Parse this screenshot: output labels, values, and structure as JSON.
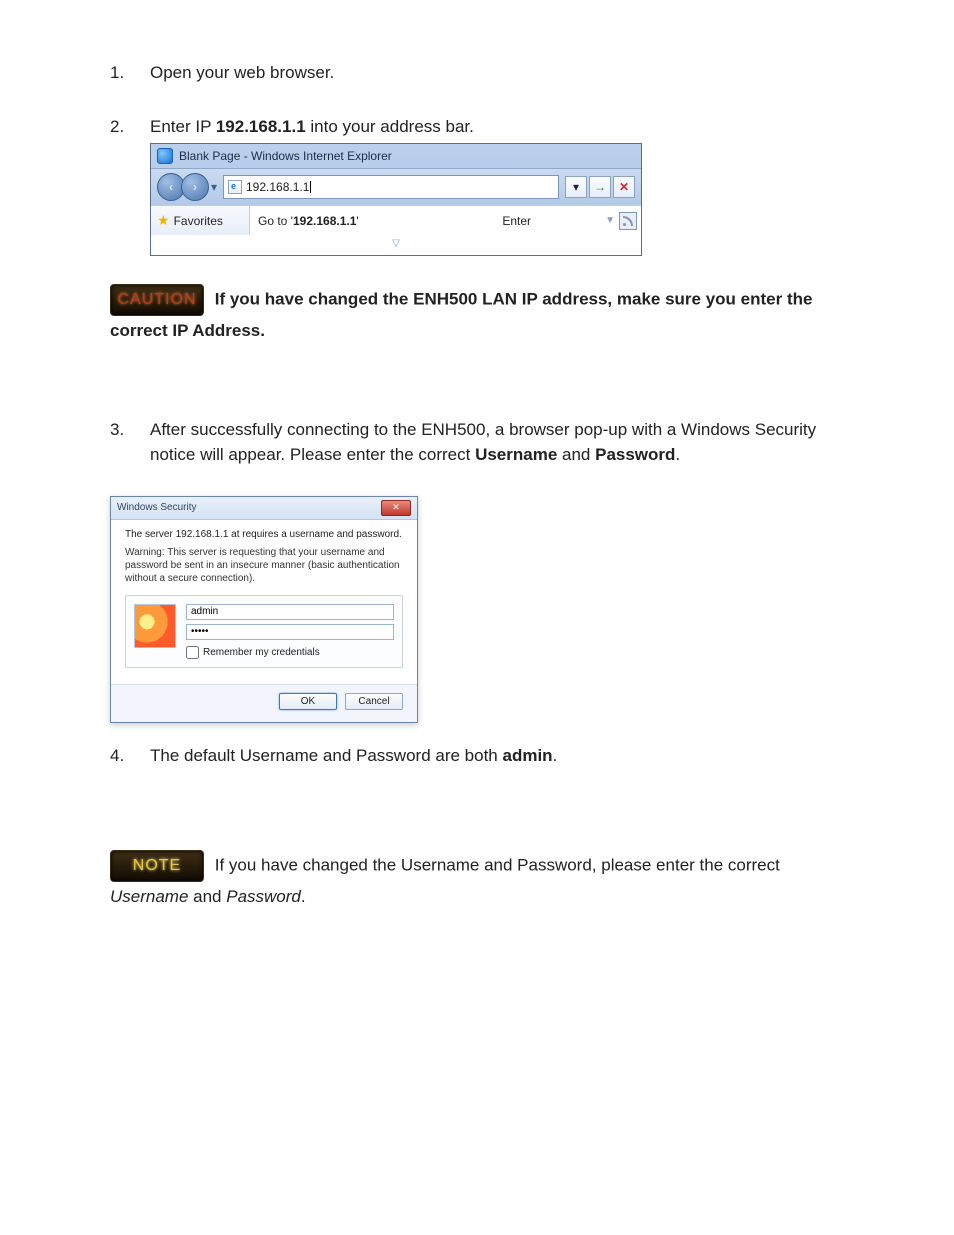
{
  "steps": {
    "s1": {
      "num": "1.",
      "text": "Open your web browser."
    },
    "s2": {
      "num": "2.",
      "pre": "Enter IP ",
      "ip": "192.168.1.1",
      "post": " into your address bar."
    },
    "s3": {
      "num": "3.",
      "a": "After successfully connecting to the ENH500, a browser pop-up with a Windows Security notice will appear. Please enter the correct ",
      "u": "Username",
      "mid": " and ",
      "p": "Password",
      "end": "."
    },
    "s4": {
      "num": "4.",
      "a": "The default Username and Password are both ",
      "b": "admin",
      "end": "."
    }
  },
  "ie": {
    "title": "Blank Page - Windows Internet Explorer",
    "address": "192.168.1.1",
    "goto_pre": "Go to ' ",
    "goto_ip": "192.168.1.1",
    "goto_post": " '",
    "enter": "Enter",
    "favorites": "Favorites"
  },
  "caution": {
    "label": "CAUTION",
    "text": "If you have changed the ENH500 LAN IP address, make sure you enter the correct IP Address."
  },
  "winsec": {
    "title": "Windows Security",
    "line1": "The server 192.168.1.1 at  requires a username and password.",
    "warn": "Warning: This server is requesting that your username and password be sent in an insecure manner (basic authentication without a secure connection).",
    "username": "admin",
    "password": "•••••",
    "remember": "Remember my credentials",
    "ok": "OK",
    "cancel": "Cancel"
  },
  "note": {
    "label": "NOTE",
    "a": "If you have changed the Username and Password, please enter the correct ",
    "u": "Username",
    "mid": " and ",
    "p": "Password",
    "end": "."
  }
}
